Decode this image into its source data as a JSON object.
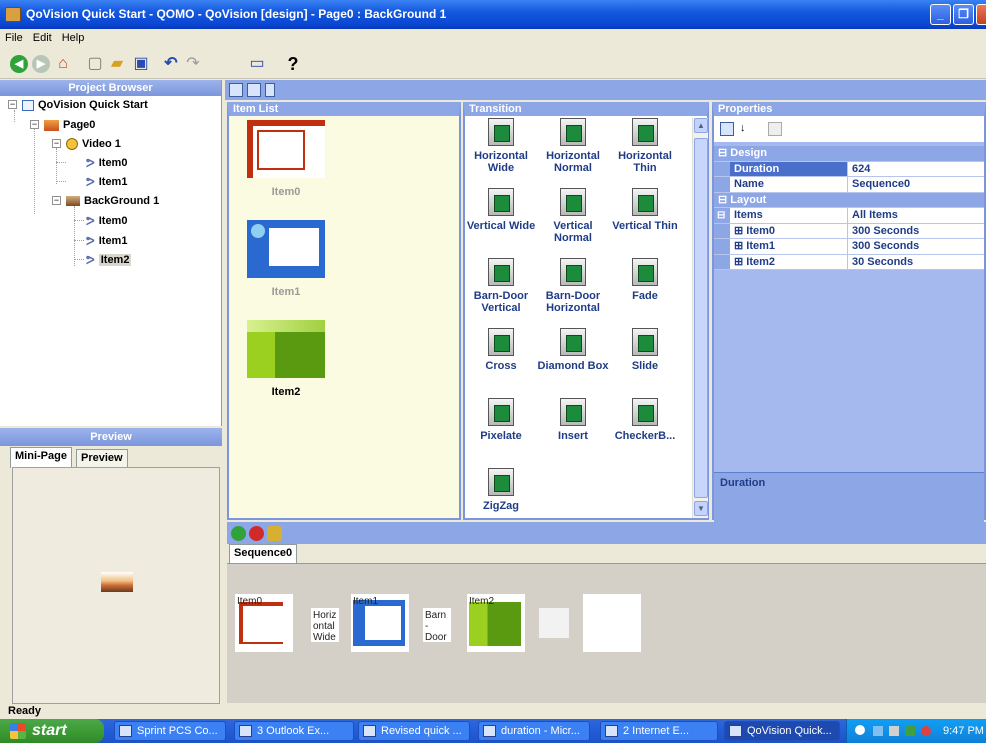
{
  "window": {
    "title": "QoVision Quick Start - QOMO - QoVision [design] - Page0 : BackGround 1"
  },
  "menu": [
    "File",
    "Edit",
    "Help"
  ],
  "project_browser": {
    "title": "Project Browser",
    "root": "QoVision Quick Start",
    "page": "Page0",
    "video": "Video 1",
    "video_items": [
      "Item0",
      "Item1"
    ],
    "background": "BackGround 1",
    "background_items": [
      "Item0",
      "Item1",
      "Item2"
    ]
  },
  "preview": {
    "title": "Preview",
    "tabs": [
      "Mini-Page",
      "Preview"
    ]
  },
  "item_list": {
    "title": "Item List",
    "items": [
      "Item0",
      "Item1",
      "Item2"
    ]
  },
  "transition": {
    "title": "Transition",
    "items": [
      "Horizontal Wide",
      "Horizontal Normal",
      "Horizontal Thin",
      "Vertical Wide",
      "Vertical Normal",
      "Vertical Thin",
      "Barn-Door Vertical",
      "Barn-Door Horizontal",
      "Fade",
      "Cross",
      "Diamond Box",
      "Slide",
      "Pixelate",
      "Insert",
      "CheckerB...",
      "ZigZag"
    ]
  },
  "properties": {
    "title": "Properties",
    "cat_design": "Design",
    "duration_label": "Duration",
    "duration_value": "624",
    "name_label": "Name",
    "name_value": "Sequence0",
    "cat_layout": "Layout",
    "items_label": "Items",
    "items_value": "All Items",
    "rows": [
      {
        "name": "Item0",
        "value": "300 Seconds"
      },
      {
        "name": "Item1",
        "value": "300 Seconds"
      },
      {
        "name": "Item2",
        "value": "30 Seconds"
      }
    ],
    "description_title": "Duration"
  },
  "sequence": {
    "tab": "Sequence0",
    "cards": [
      "Item0",
      "Item1",
      "Item2"
    ],
    "transitions": [
      "Horiz ontal Wide",
      "Barn - Door"
    ]
  },
  "status": "Ready",
  "taskbar": {
    "start": "start",
    "tasks": [
      "Sprint PCS Co...",
      "3 Outlook Ex...",
      "Revised quick ...",
      "duration - Micr...",
      "2 Internet E...",
      "QoVision Quick..."
    ],
    "clock": "9:47 PM"
  }
}
